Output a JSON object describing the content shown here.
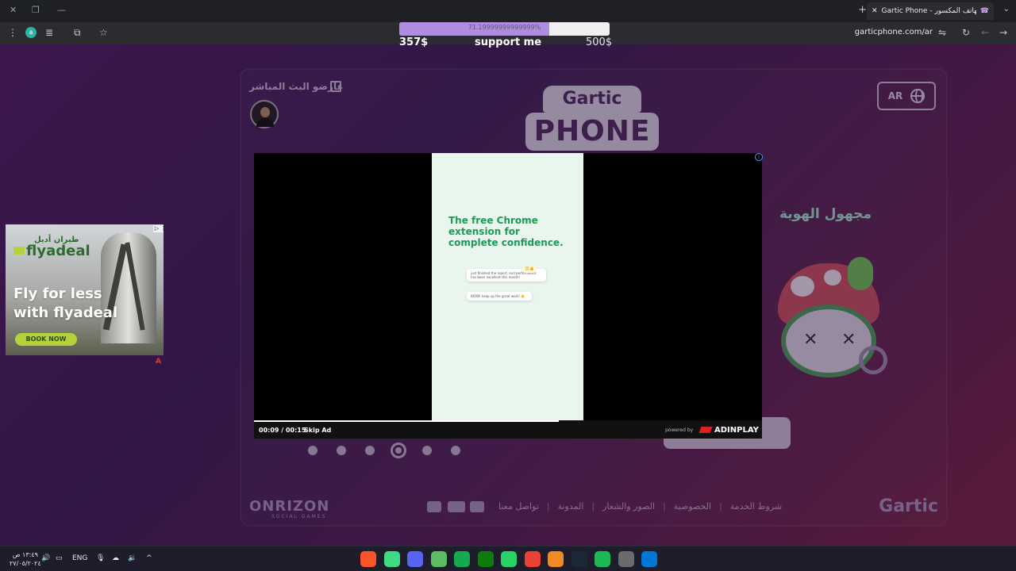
{
  "browser": {
    "tab_title": "Gartic Phone - الهاتف المكسور",
    "url": "garticphone.com/ar",
    "profile_initial": "a"
  },
  "donation": {
    "percent_text": "71.19999999999999%",
    "fill_fraction": 0.712,
    "current": "357$",
    "label": "support me",
    "goal": "500$"
  },
  "header": {
    "streamers_label": "عارضو البث المباشر",
    "logo_top": "Gartic",
    "logo_bottom": "PHONE",
    "language": "AR"
  },
  "player": {
    "nickname": "مجهول الهوية"
  },
  "carousel": {
    "count": 6,
    "active_index": 3
  },
  "footer": {
    "brand": "ONRIZON",
    "brand_sub": "SOCIAL GAMES",
    "links": [
      "شروط الخدمة",
      "الخصوصية",
      "الصور والشعار",
      "المدونة",
      "تواصل معنا"
    ],
    "gartic": "Gartic"
  },
  "side_ad": {
    "arabic_brand": "طيران أديل",
    "brand": "flyadeal",
    "slogan": "Fly for less with flyadeal",
    "cta": "BOOK NOW"
  },
  "video_ad": {
    "headline": "The free Chrome extension for complete confidence.",
    "card1": "just finished the report, and performance has been excellent this month!",
    "card2": "WOW! keep up the great work! 👏",
    "time": "00:09 / 00:15",
    "skip_label": "Skip Ad",
    "progress_fraction": 0.6,
    "powered_by": "powered by",
    "brand": "ADINPLAY"
  },
  "taskbar": {
    "time": "١٣:٤٩ ص",
    "date": "٢٧/٠٥/٢٠٢٤",
    "lang": "ENG",
    "apps": [
      {
        "name": "brave-icon",
        "color": "#fb542b"
      },
      {
        "name": "browser-icon",
        "color": "#3ddc84"
      },
      {
        "name": "discord-icon",
        "color": "#5865f2"
      },
      {
        "name": "vanguard-icon",
        "color": "#5dbb63"
      },
      {
        "name": "mongodb-icon",
        "color": "#13aa52"
      },
      {
        "name": "xbox-icon",
        "color": "#107c10"
      },
      {
        "name": "whatsapp-icon",
        "color": "#25d366"
      },
      {
        "name": "chrome-icon",
        "color": "#ea4335"
      },
      {
        "name": "app-orange-icon",
        "color": "#f08a24"
      },
      {
        "name": "steam-icon",
        "color": "#1b2838"
      },
      {
        "name": "spotify-icon",
        "color": "#1db954"
      },
      {
        "name": "app-gray-icon",
        "color": "#6b6b6b"
      },
      {
        "name": "windows-icon",
        "color": "#0078d4"
      }
    ]
  }
}
